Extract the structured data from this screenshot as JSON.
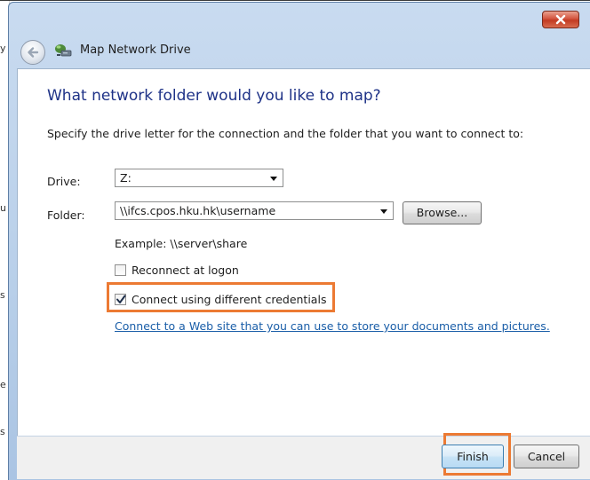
{
  "window": {
    "title": "Map Network Drive",
    "close_label": "×"
  },
  "wizard": {
    "heading": "What network folder would you like to map?",
    "instruction": "Specify the drive letter for the connection and the folder that you want to connect to:",
    "drive": {
      "label": "Drive:",
      "value": "Z:"
    },
    "folder": {
      "label": "Folder:",
      "value": "\\\\ifcs.cpos.hku.hk\\username",
      "browse_label": "Browse..."
    },
    "example": "Example: \\\\server\\share",
    "reconnect": {
      "label": "Reconnect at logon",
      "checked": false
    },
    "credentials": {
      "label": "Connect using different credentials",
      "checked": true
    },
    "link": "Connect to a Web site that you can use to store your documents and pictures."
  },
  "footer": {
    "finish_label": "Finish",
    "cancel_label": "Cancel"
  },
  "colors": {
    "highlight": "#ec7a33",
    "heading": "#1e3287",
    "link": "#1a5ea8",
    "close": "#c23a22"
  },
  "icons": [
    "back-arrow-icon",
    "network-drive-icon",
    "close-icon",
    "dropdown-arrow-icon",
    "checkmark-icon"
  ]
}
